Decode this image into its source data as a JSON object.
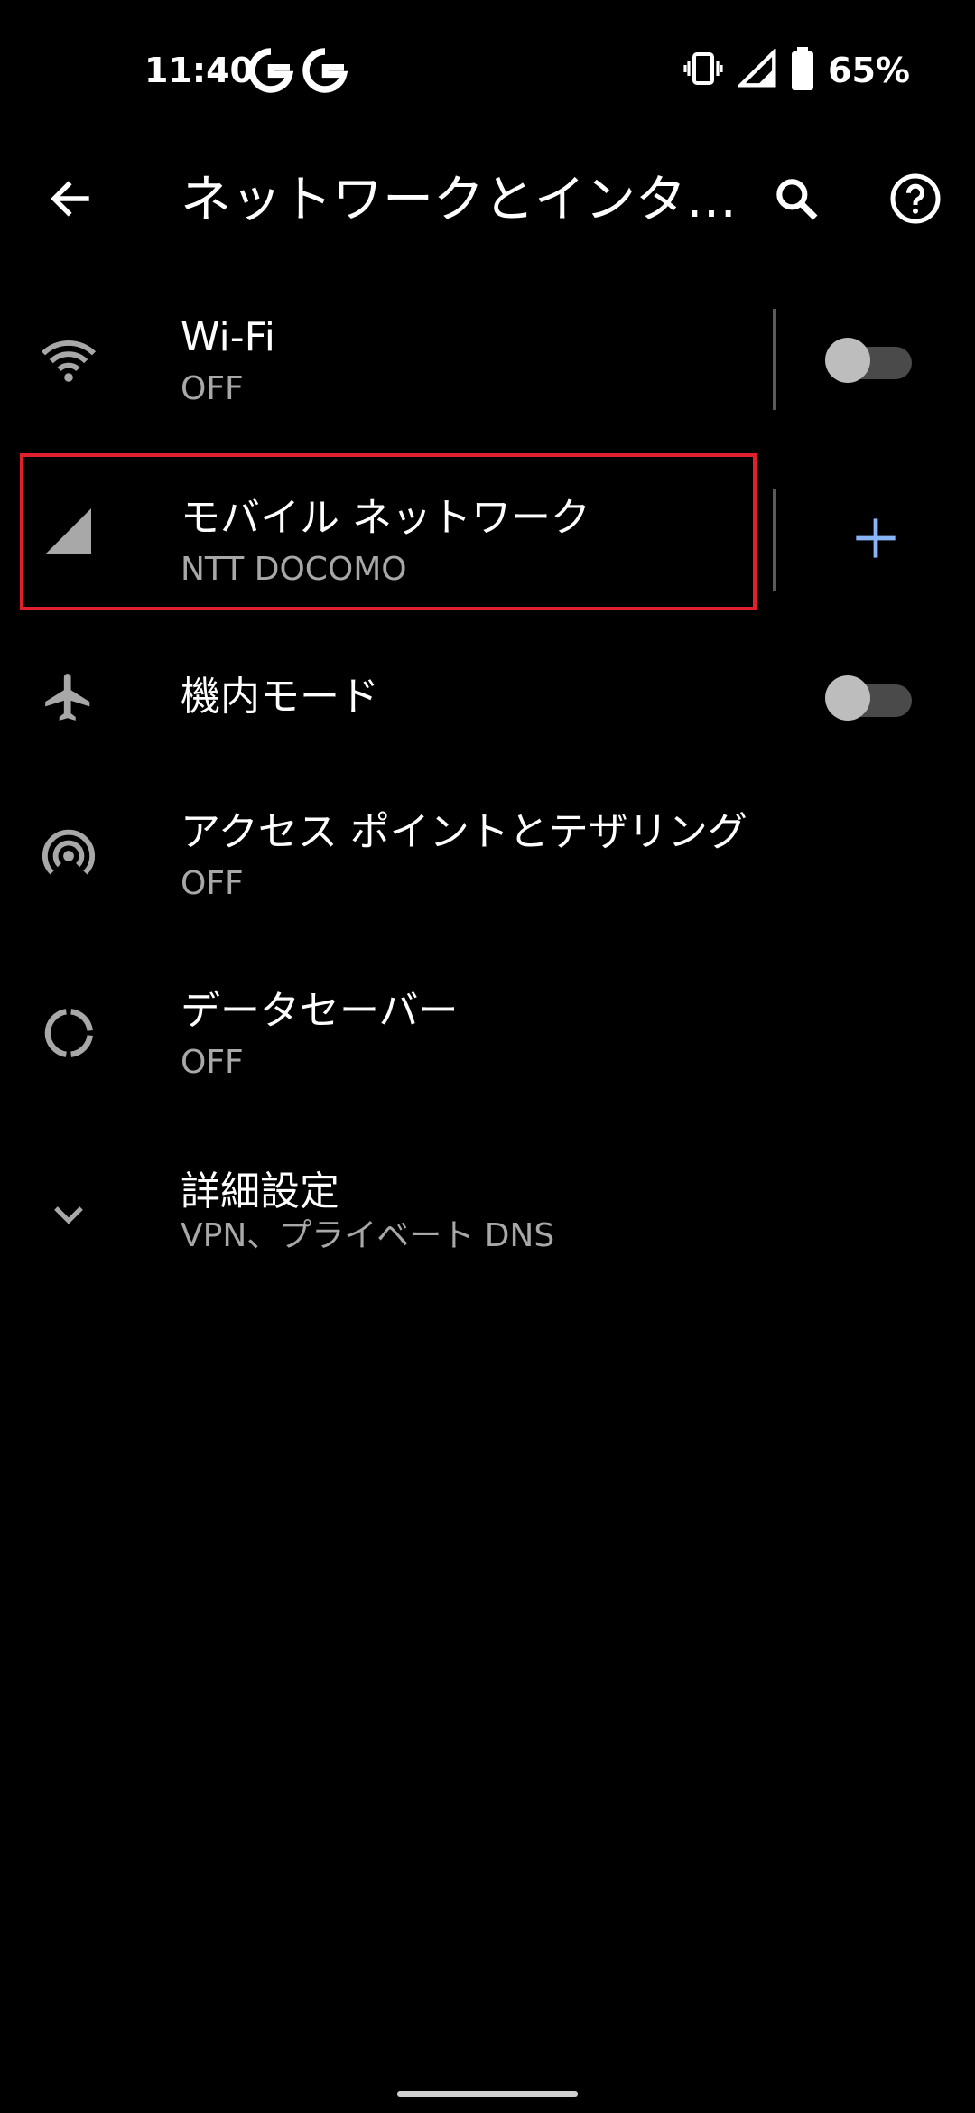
{
  "status_bar": {
    "time": "11:40",
    "notifications": [
      "google-g-icon",
      "google-g-icon"
    ],
    "icons": [
      "vibrate-icon",
      "cell-signal-icon",
      "battery-icon"
    ],
    "battery_percent": "65%"
  },
  "toolbar": {
    "back_icon": "arrow-left-icon",
    "title": "ネットワークとインタ…",
    "search_icon": "search-icon",
    "help_icon": "help-circle-icon"
  },
  "list": [
    {
      "id": "wifi",
      "icon": "wifi-icon",
      "title": "Wi-Fi",
      "subtitle": "OFF",
      "control": "toggle",
      "toggle_on": false
    },
    {
      "id": "mobile",
      "icon": "cell-signal-icon",
      "title": "モバイル ネットワーク",
      "subtitle": "NTT DOCOMO",
      "control": "add",
      "highlighted": true
    },
    {
      "id": "airplane",
      "icon": "airplane-icon",
      "title": "機内モード",
      "subtitle": "",
      "control": "toggle",
      "toggle_on": false
    },
    {
      "id": "hotspot",
      "icon": "hotspot-icon",
      "title": "アクセス ポイントとテザリング",
      "subtitle": "OFF"
    },
    {
      "id": "datasaver",
      "icon": "data-saver-icon",
      "title": "データセーバー",
      "subtitle": "OFF"
    },
    {
      "id": "advanced",
      "icon": "chevron-down-icon",
      "title": "詳細設定",
      "subtitle": "VPN、プライベート DNS"
    }
  ],
  "colors": {
    "background": "#000000",
    "primary_text": "#ffffff",
    "secondary_text": "#a8a8a8",
    "accent": "#8ab4f8",
    "highlight_border": "#e0202a"
  }
}
